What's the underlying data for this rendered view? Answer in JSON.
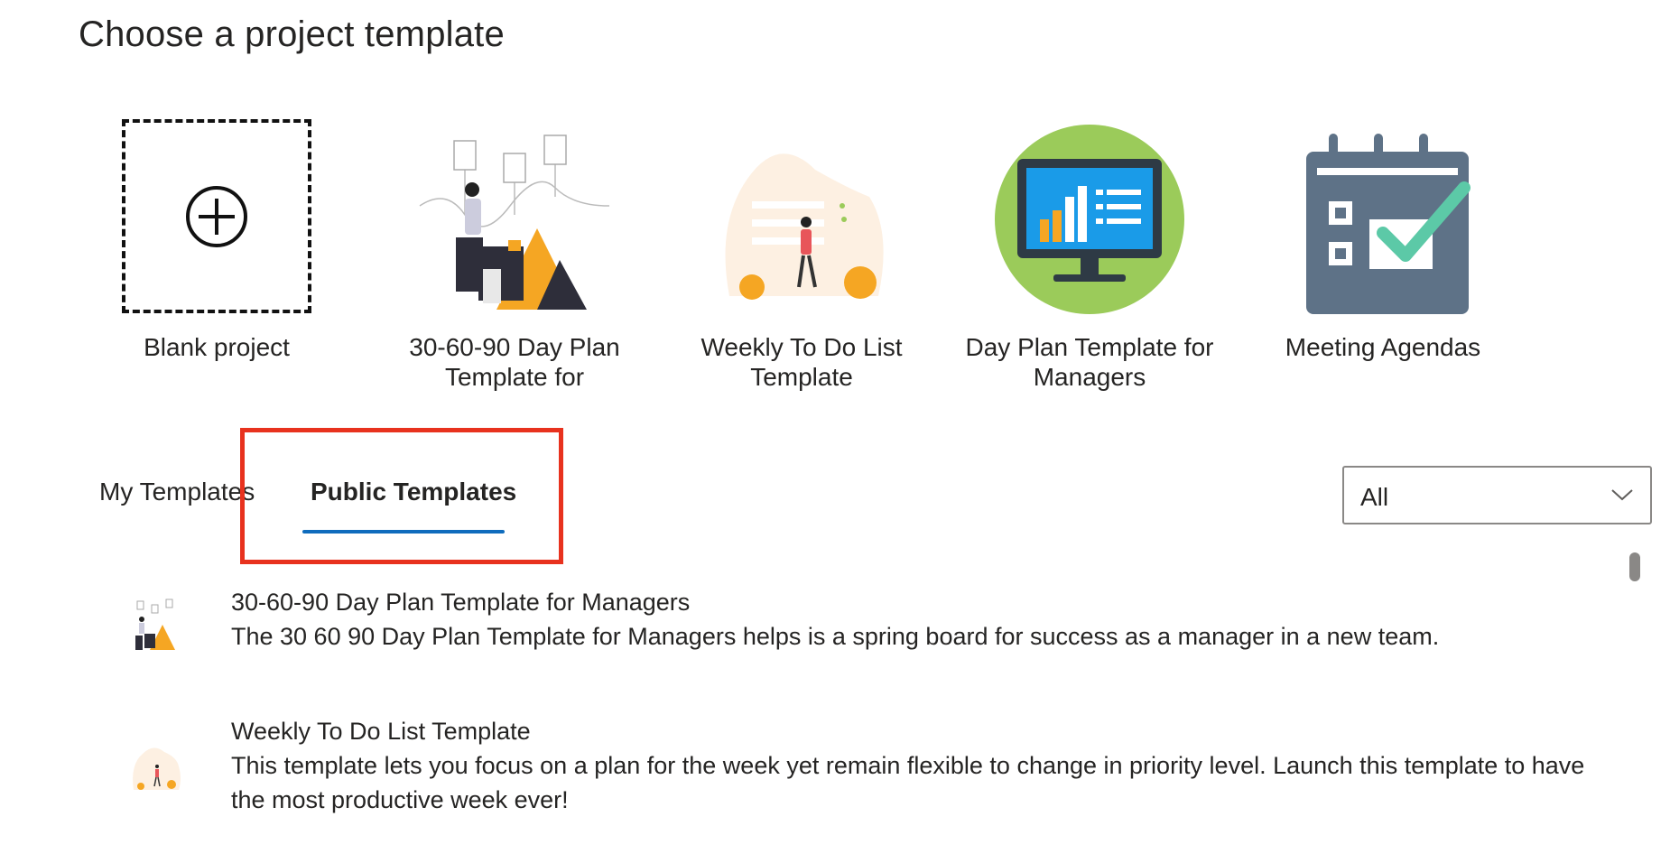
{
  "page": {
    "title": "Choose a project template"
  },
  "featured": [
    {
      "label": "Blank project",
      "icon": "plus-circle-icon"
    },
    {
      "label": "30-60-90 Day Plan Template for",
      "icon": "woman-mountains-illustration"
    },
    {
      "label": "Weekly To Do List Template",
      "icon": "woman-walking-illustration"
    },
    {
      "label": "Day Plan Template for Managers",
      "icon": "monitor-chart-illustration"
    },
    {
      "label": "Meeting Agendas",
      "icon": "calendar-check-icon"
    }
  ],
  "tabs": [
    {
      "label": "My Templates",
      "active": false
    },
    {
      "label": "Public Templates",
      "active": true
    }
  ],
  "filter": {
    "value": "All",
    "icon": "chevron-down-icon"
  },
  "list": [
    {
      "title": "30-60-90 Day Plan Template for Managers",
      "description": "The 30 60 90 Day Plan Template for Managers helps is a spring board for success as a manager in a new team."
    },
    {
      "title": "Weekly To Do List Template",
      "description": "This template lets you focus on a plan for the week yet remain flexible to change in priority level. Launch this template to have the most productive week ever!"
    }
  ],
  "colors": {
    "accent": "#0f6cbd",
    "highlight": "#e8321e",
    "orange": "#f5a623",
    "green": "#9bcb5a",
    "slate": "#5e7287"
  }
}
